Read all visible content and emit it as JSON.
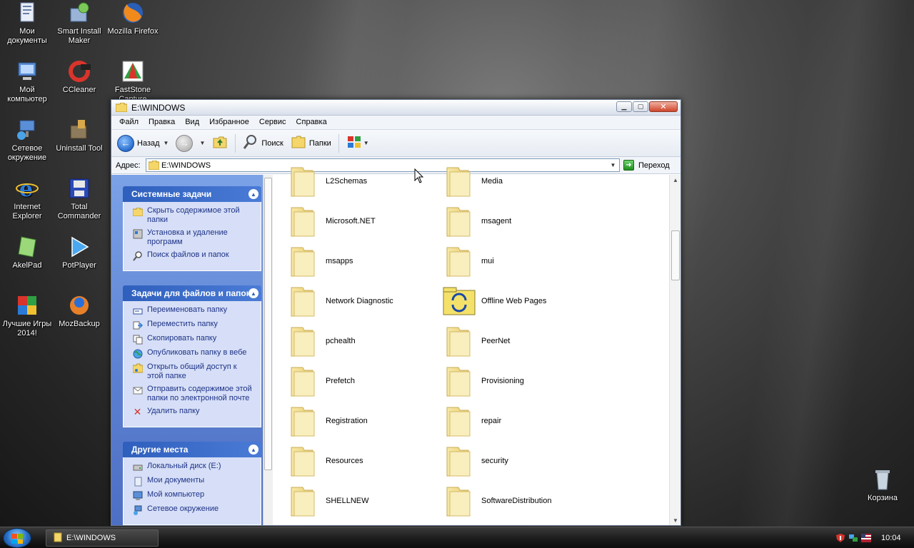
{
  "desktop": {
    "icons": [
      {
        "label": "Мои документы",
        "icon": "my-documents-icon"
      },
      {
        "label": "Smart Install Maker",
        "icon": "installer-icon"
      },
      {
        "label": "Mozilla Firefox",
        "icon": "firefox-icon"
      },
      {
        "label": "Мой компьютер",
        "icon": "my-computer-icon"
      },
      {
        "label": "CCleaner",
        "icon": "ccleaner-icon"
      },
      {
        "label": "FastStone Capture",
        "icon": "faststone-icon"
      },
      {
        "label": "Сетевое окружение",
        "icon": "network-icon"
      },
      {
        "label": "Uninstall Tool",
        "icon": "uninstall-icon"
      },
      {
        "label": "Internet Explorer",
        "icon": "ie-icon"
      },
      {
        "label": "Total Commander",
        "icon": "total-commander-icon"
      },
      {
        "label": "AkelPad",
        "icon": "akelpad-icon"
      },
      {
        "label": "PotPlayer",
        "icon": "potplayer-icon"
      },
      {
        "label": "Лучшие Игры 2014!",
        "icon": "games-icon"
      },
      {
        "label": "MozBackup",
        "icon": "mozbackup-icon"
      },
      {
        "label": "Корзина",
        "icon": "recycle-bin-icon"
      }
    ]
  },
  "window": {
    "title": "E:\\WINDOWS",
    "menu": [
      "Файл",
      "Правка",
      "Вид",
      "Избранное",
      "Сервис",
      "Справка"
    ],
    "toolbar": {
      "back_label": "Назад",
      "search_label": "Поиск",
      "folders_label": "Папки"
    },
    "address": {
      "label": "Адрес:",
      "value": "E:\\WINDOWS",
      "go_label": "Переход"
    },
    "taskpane": {
      "system_tasks": {
        "title": "Системные задачи",
        "items": [
          "Скрыть содержимое этой папки",
          "Установка и удаление программ",
          "Поиск файлов и папок"
        ]
      },
      "file_tasks": {
        "title": "Задачи для файлов и папок",
        "items": [
          "Переименовать папку",
          "Переместить папку",
          "Скопировать папку",
          "Опубликовать папку в вебе",
          "Открыть общий доступ к этой папке",
          "Отправить содержимое этой папки по электронной почте",
          "Удалить папку"
        ]
      },
      "other_places": {
        "title": "Другие места",
        "items": [
          "Локальный диск (E:)",
          "Мои документы",
          "Мой компьютер",
          "Сетевое окружение"
        ]
      }
    },
    "folders": [
      "L2Schemas",
      "Media",
      "Microsoft.NET",
      "msagent",
      "msapps",
      "mui",
      "Network Diagnostic",
      "Offline Web Pages",
      "pchealth",
      "PeerNet",
      "Prefetch",
      "Provisioning",
      "Registration",
      "repair",
      "Resources",
      "security",
      "SHELLNEW",
      "SoftwareDistribution"
    ]
  },
  "taskbar": {
    "active_window": "E:\\WINDOWS",
    "clock": "10:04"
  }
}
